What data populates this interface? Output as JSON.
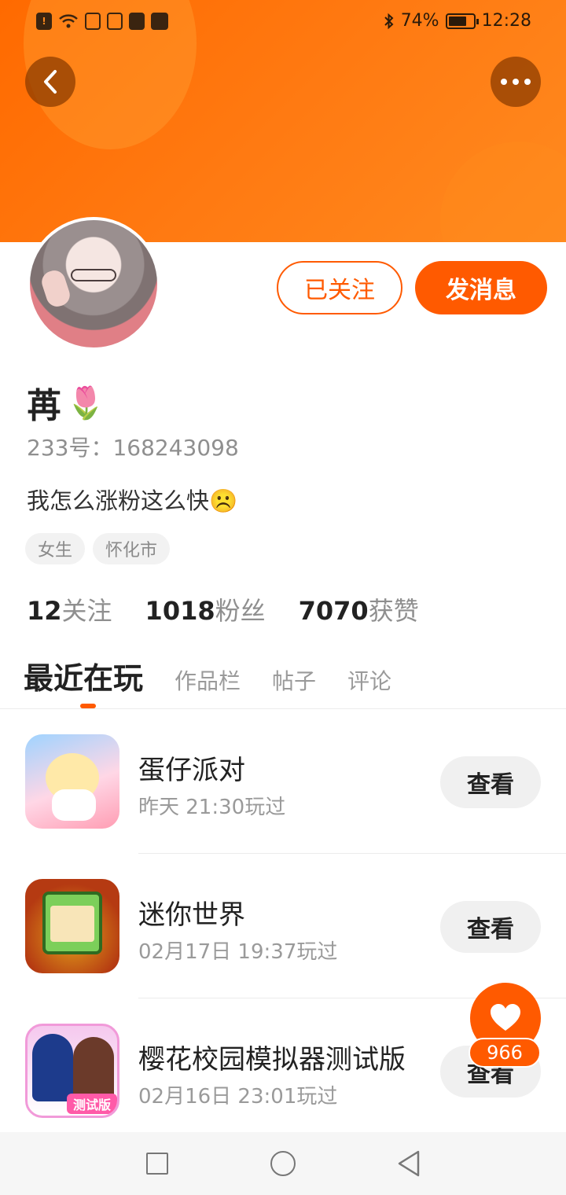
{
  "status_bar": {
    "battery_percent": "74%",
    "time": "12:28",
    "battery_level": 0.74
  },
  "profile": {
    "nickname": "苒",
    "nickname_emoji": "🌷",
    "uid": "233号：168243098",
    "bio": "我怎么涨粉这么快☹️",
    "tags": [
      "女生",
      "怀化市"
    ],
    "follow_button": "已关注",
    "message_button": "发消息"
  },
  "stats": {
    "following_count": "12",
    "following_label": "关注",
    "fans_count": "1018",
    "fans_label": "粉丝",
    "likes_count": "7070",
    "likes_label": "获赞"
  },
  "tabs": [
    {
      "label": "最近在玩",
      "active": true
    },
    {
      "label": "作品栏",
      "active": false
    },
    {
      "label": "帖子",
      "active": false
    },
    {
      "label": "评论",
      "active": false
    }
  ],
  "recent_games": [
    {
      "title": "蛋仔派对",
      "time": "昨天 21:30玩过",
      "button": "查看"
    },
    {
      "title": "迷你世界",
      "time": "02月17日 19:37玩过",
      "button": "查看"
    },
    {
      "title": "樱花校园模拟器测试版",
      "time": "02月16日 23:01玩过",
      "button": "查看",
      "icon_badge": "测试版"
    }
  ],
  "like_fab": {
    "count": "966"
  },
  "colors": {
    "accent": "#ff5a00",
    "banner": "#ff7a12",
    "muted_text": "#8f8f8f"
  },
  "icons": {
    "back": "chevron-left-icon",
    "more": "more-dots-icon",
    "like": "heart-icon",
    "nav_recent": "square-icon",
    "nav_home": "circle-icon",
    "nav_back": "triangle-back-icon"
  }
}
